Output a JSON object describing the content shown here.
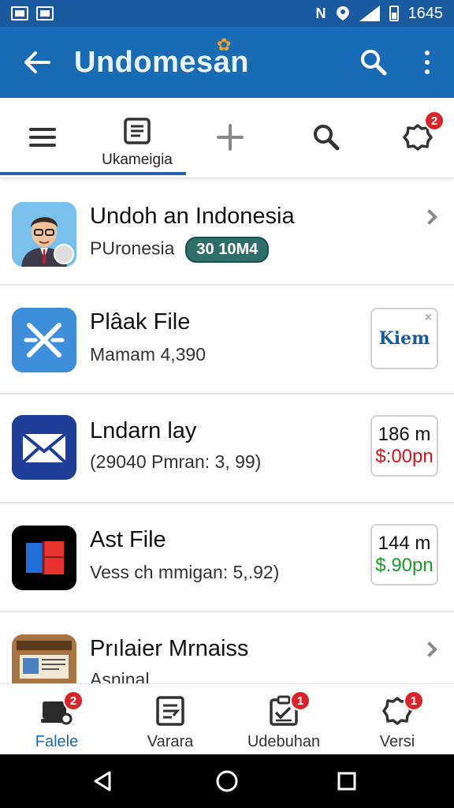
{
  "status_bar": {
    "time": "1645"
  },
  "app_bar": {
    "title": "Undomesan"
  },
  "toolbar": {
    "items": [
      {
        "label": ""
      },
      {
        "label": "Ukameigia"
      },
      {
        "label": ""
      },
      {
        "label": ""
      },
      {
        "label": "",
        "badge": "2"
      }
    ]
  },
  "list": [
    {
      "title": "Undoh an Indonesia",
      "subtitle": "PUronesia",
      "pill": "30 10M4"
    },
    {
      "title": "Plâak File",
      "subtitle": "Mamam 4,390",
      "side_text": "Kiem",
      "side_close": "×"
    },
    {
      "title": "Lndarn lay",
      "subtitle": "(29040 Pmran: 3, 99)",
      "price_top": "186 m",
      "price_bottom": "$:00pn",
      "price_color": "#d0161b"
    },
    {
      "title": "Ast File",
      "subtitle": "Vess ch  mmigan: 5,.92)",
      "price_top": "144 m",
      "price_bottom": "$.90pn",
      "price_color": "#1a9a2a"
    },
    {
      "title": "Prılaier Mrnaiss",
      "subtitle": "Asninal"
    }
  ],
  "bottom_nav": [
    {
      "label": "Falele",
      "badge": "2"
    },
    {
      "label": "Varara"
    },
    {
      "label": "Udebuhan",
      "badge": "1"
    },
    {
      "label": "Versi",
      "badge": "1"
    }
  ]
}
